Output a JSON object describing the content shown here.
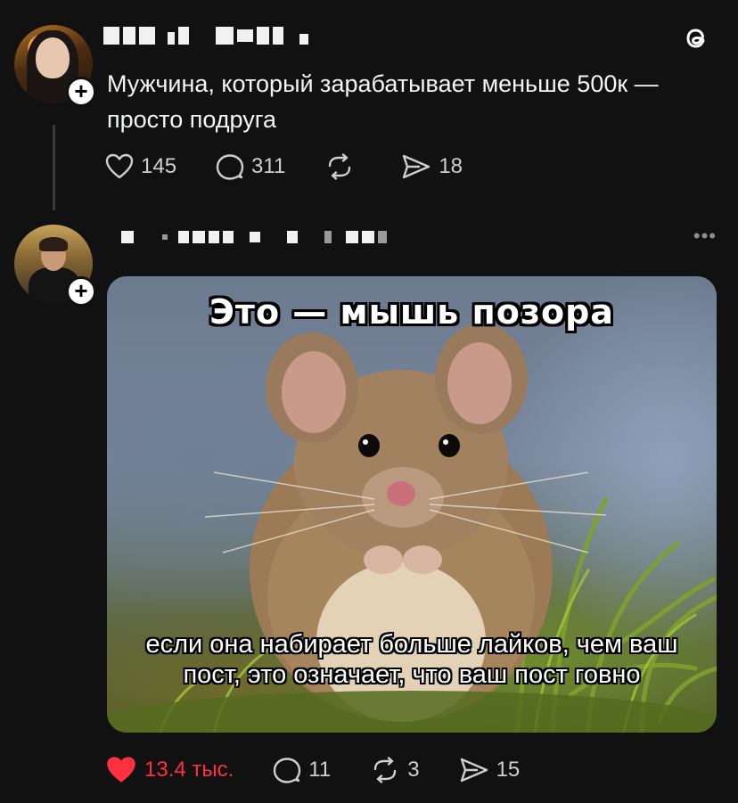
{
  "post1": {
    "author_name_redacted": true,
    "text": "Мужчина, который зарабатывает меньше 500к — просто подруга",
    "stats": {
      "likes": "145",
      "replies": "311",
      "reposts": "",
      "shares": "18"
    },
    "avatar_icon": "profile-photo-girl",
    "follow_icon": "plus-icon"
  },
  "post2": {
    "author_name_redacted": true,
    "meme_top": "Это — мышь позора",
    "meme_bottom": "если она набирает больше лайков, чем ваш пост, это означает, что ваш пост говно",
    "stats": {
      "likes": "13.4 тыс.",
      "replies": "11",
      "reposts": "3",
      "shares": "15"
    },
    "liked": true,
    "avatar_icon": "profile-photo-guy",
    "more_label": "•••"
  },
  "colors": {
    "background": "#111111",
    "text": "#f3f5f7",
    "like_active": "#ff3040",
    "muted": "#cfcfcf"
  },
  "app_icon": "threads-logo-icon"
}
